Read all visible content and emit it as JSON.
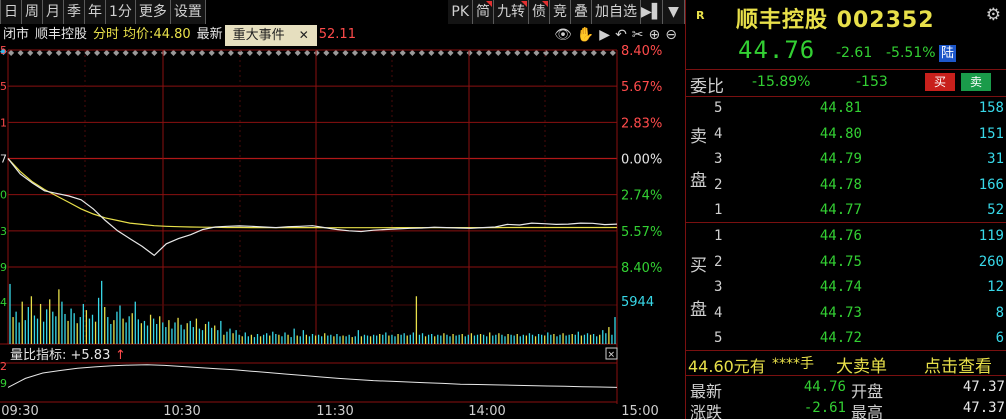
{
  "toolbar": {
    "left_buttons": [
      "日",
      "周",
      "月",
      "季",
      "年",
      "1分",
      "更多",
      "设置"
    ],
    "right_buttons": [
      {
        "label": "PK",
        "flag": false
      },
      {
        "label": "简",
        "flag": true
      },
      {
        "label": "九转",
        "flag": true
      },
      {
        "label": "债",
        "flag": true
      },
      {
        "label": "竞",
        "flag": false
      },
      {
        "label": "叠",
        "flag": false
      },
      {
        "label": "加自选",
        "flag": false
      }
    ],
    "expand_icon": "▶▌",
    "menu_icon": "▼"
  },
  "info_row": {
    "status": "闭市",
    "stock_name": "顺丰控股",
    "mode": "分时",
    "avg_label": "均价:",
    "avg_value": "44.80",
    "latest_label": "最新",
    "event_button": "重大事件",
    "event_close": "✕",
    "hidden_value": "52.11",
    "tool_icons": [
      "eye-icon",
      "hand-icon",
      "play-icon",
      "undo-icon",
      "scissors-icon",
      "zoom-in-icon",
      "zoom-out-icon"
    ]
  },
  "chart_data": {
    "type": "line",
    "price_axis_left": [
      "5",
      "5",
      "1",
      "7",
      "0",
      "3",
      "9"
    ],
    "price_axis_right": [
      "8.40%",
      "5.67%",
      "2.83%",
      "0.00%",
      "2.74%",
      "5.57%",
      "8.40%"
    ],
    "price_axis_right_colors": [
      "#ff4b4b",
      "#ff4b4b",
      "#ff4b4b",
      "#e6e6e6",
      "#33d033",
      "#33d033",
      "#33d033"
    ],
    "volume_axis_left": "4",
    "volume_label": "5944",
    "x_labels": [
      "09:30",
      "10:30",
      "11:30",
      "14:00",
      "15:00"
    ],
    "pct_range": [
      -8.4,
      8.4
    ],
    "price_series": [
      0.0,
      -1.2,
      -1.9,
      -2.5,
      -2.7,
      -2.9,
      -3.2,
      -3.9,
      -4.8,
      -5.6,
      -6.2,
      -6.8,
      -7.5,
      -6.6,
      -6.2,
      -5.9,
      -5.5,
      -5.3,
      -5.25,
      -5.22,
      -5.25,
      -5.3,
      -5.35,
      -5.28,
      -5.25,
      -5.2,
      -5.35,
      -5.5,
      -5.6,
      -5.65,
      -5.55,
      -5.5,
      -5.45,
      -5.4,
      -5.38,
      -5.32,
      -5.35,
      -5.38,
      -5.4,
      -5.35,
      -5.3,
      -5.1,
      -5.15,
      -5.0,
      -5.05,
      -5.1,
      -5.08,
      -5.0,
      -5.02,
      -5.12,
      -5.08
    ],
    "avg_series": [
      0.0,
      -1.0,
      -1.8,
      -2.4,
      -2.9,
      -3.4,
      -3.9,
      -4.3,
      -4.6,
      -4.8,
      -5.0,
      -5.1,
      -5.2,
      -5.25,
      -5.28,
      -5.3,
      -5.32,
      -5.33,
      -5.34,
      -5.34,
      -5.35,
      -5.35,
      -5.35,
      -5.35,
      -5.35,
      -5.35,
      -5.36,
      -5.36,
      -5.36,
      -5.36,
      -5.36,
      -5.36,
      -5.35,
      -5.35,
      -5.35,
      -5.35,
      -5.35,
      -5.35,
      -5.35,
      -5.35,
      -5.35,
      -5.34,
      -5.34,
      -5.34,
      -5.34,
      -5.34,
      -5.34,
      -5.34,
      -5.34,
      -5.34,
      -5.34
    ],
    "volume_series": [
      0.78,
      0.35,
      0.42,
      0.28,
      0.55,
      0.31,
      0.48,
      0.62,
      0.37,
      0.33,
      0.52,
      0.29,
      0.45,
      0.58,
      0.42,
      0.36,
      0.71,
      0.55,
      0.39,
      0.3,
      0.46,
      0.4,
      0.27,
      0.35,
      0.52,
      0.44,
      0.33,
      0.38,
      0.29,
      0.6,
      0.82,
      0.48,
      0.35,
      0.26,
      0.31,
      0.42,
      0.5,
      0.33,
      0.28,
      0.36,
      0.4,
      0.55,
      0.32,
      0.27,
      0.3,
      0.24,
      0.38,
      0.33,
      0.26,
      0.36,
      0.28,
      0.22,
      0.31,
      0.2,
      0.28,
      0.34,
      0.25,
      0.19,
      0.27,
      0.3,
      0.22,
      0.33,
      0.2,
      0.18,
      0.26,
      0.29,
      0.21,
      0.24,
      0.18,
      0.3,
      0.12,
      0.16,
      0.2,
      0.14,
      0.18,
      0.12,
      0.1,
      0.15,
      0.1,
      0.12,
      0.09,
      0.13,
      0.1,
      0.12,
      0.14,
      0.11,
      0.16,
      0.13,
      0.12,
      0.1,
      0.15,
      0.12,
      0.09,
      0.2,
      0.11,
      0.1,
      0.18,
      0.12,
      0.1,
      0.13,
      0.11,
      0.12,
      0.1,
      0.14,
      0.11,
      0.12,
      0.1,
      0.13,
      0.1,
      0.11,
      0.1,
      0.12,
      0.09,
      0.1,
      0.18,
      0.1,
      0.12,
      0.11,
      0.1,
      0.12,
      0.11,
      0.13,
      0.12,
      0.15,
      0.11,
      0.12,
      0.1,
      0.13,
      0.12,
      0.14,
      0.11,
      0.12,
      0.15,
      0.62,
      0.12,
      0.14,
      0.1,
      0.12,
      0.13,
      0.1,
      0.12,
      0.11,
      0.14,
      0.12,
      0.1,
      0.13,
      0.11,
      0.12,
      0.13,
      0.1,
      0.12,
      0.14,
      0.11,
      0.12,
      0.13,
      0.12,
      0.1,
      0.15,
      0.11,
      0.12,
      0.14,
      0.12,
      0.1,
      0.13,
      0.12,
      0.11,
      0.13,
      0.1,
      0.12,
      0.11,
      0.14,
      0.12,
      0.1,
      0.13,
      0.12,
      0.11,
      0.15,
      0.12,
      0.13,
      0.1,
      0.12,
      0.14,
      0.11,
      0.12,
      0.13,
      0.12,
      0.16,
      0.11,
      0.12,
      0.14,
      0.12,
      0.13,
      0.1,
      0.12,
      0.18,
      0.14,
      0.22,
      0.12,
      0.35
    ],
    "indicator_label": "量比指标: +5.83",
    "indicator_arrow": "↑",
    "indicator_axis_left": [
      "2",
      "9"
    ],
    "indicator_series": [
      0.35,
      0.6,
      0.75,
      0.82,
      0.88,
      0.92,
      0.95,
      0.97,
      0.98,
      0.96,
      0.93,
      0.9,
      0.87,
      0.84,
      0.8,
      0.76,
      0.72,
      0.68,
      0.64,
      0.6,
      0.57,
      0.54,
      0.52,
      0.5,
      0.48,
      0.46,
      0.44,
      0.43,
      0.42,
      0.41,
      0.4,
      0.39,
      0.38,
      0.37,
      0.36,
      0.35
    ]
  },
  "quote": {
    "market_tag": "R",
    "stock_title": "顺丰控股 002352",
    "price": "44.76",
    "change": "-2.61",
    "change_pct": "-5.51%",
    "exchange_badge": "陆",
    "weibi_label": "委比",
    "weibi_value": "-15.89%",
    "weicha_value": "-153",
    "sell_button": "买",
    "buy_button": "卖",
    "sell_side_label": [
      "卖",
      "盘"
    ],
    "buy_side_label": [
      "买",
      "盘"
    ],
    "asks": [
      {
        "level": "5",
        "price": "44.81",
        "volume": "158"
      },
      {
        "level": "4",
        "price": "44.80",
        "volume": "151"
      },
      {
        "level": "3",
        "price": "44.79",
        "volume": "31"
      },
      {
        "level": "2",
        "price": "44.78",
        "volume": "166"
      },
      {
        "level": "1",
        "price": "44.77",
        "volume": "52"
      }
    ],
    "bids": [
      {
        "level": "1",
        "price": "44.76",
        "volume": "119"
      },
      {
        "level": "2",
        "price": "44.75",
        "volume": "260"
      },
      {
        "level": "3",
        "price": "44.74",
        "volume": "12"
      },
      {
        "level": "4",
        "price": "44.73",
        "volume": "8"
      },
      {
        "level": "5",
        "price": "44.72",
        "volume": "6"
      }
    ],
    "big_order_amount": "44.60元有",
    "big_order_hands": "****手",
    "big_order_label": "大卖单",
    "big_order_click": "点击查看",
    "latest_label": "最新",
    "latest_value": "44.76",
    "open_label": "开盘",
    "open_value": "47.37",
    "change_label": "涨跌",
    "change_value": "-2.61",
    "high_label": "最高",
    "high_value": "47.37"
  },
  "colors": {
    "up": "#ff4b4b",
    "down": "#33d033",
    "grid_red": "#8a1010",
    "price_line": "#e8e8e8",
    "avg_line": "#e8e04a",
    "volume_up": "#e8e04a",
    "volume_down": "#38d8e8"
  }
}
